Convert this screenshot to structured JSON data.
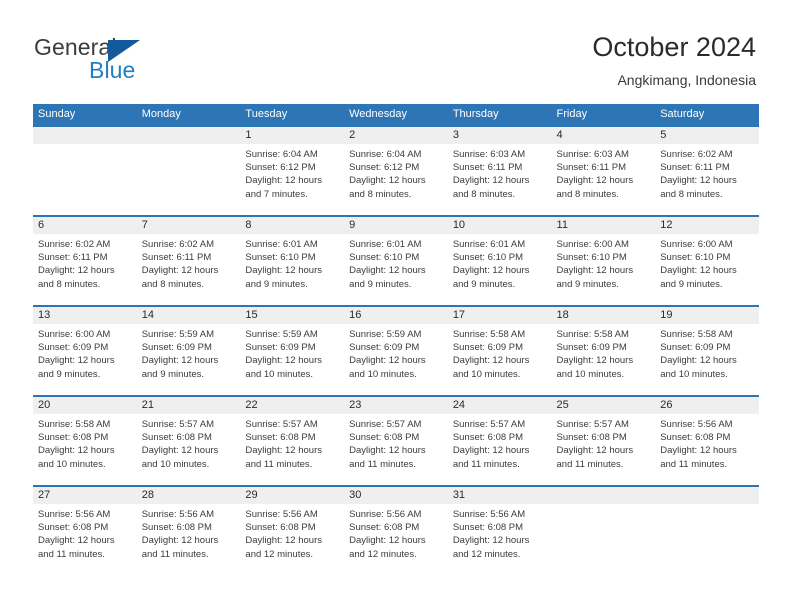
{
  "brand": {
    "line1": "General",
    "line2": "Blue",
    "triangle_icon": "brand-triangle-icon",
    "colors": {
      "dark": "#3c3c3c",
      "blue": "#1f7fc4",
      "triangle": "#125a9c"
    }
  },
  "header": {
    "title": "October 2024",
    "subtitle": "Angkimang, Indonesia"
  },
  "theme": {
    "header_blue": "#2E75B6",
    "row_rule_blue": "#2E75B6",
    "day_number_strip": "#EFEFEF",
    "text": "#3C3C3C"
  },
  "calendar": {
    "weekdays": [
      "Sunday",
      "Monday",
      "Tuesday",
      "Wednesday",
      "Thursday",
      "Friday",
      "Saturday"
    ],
    "weeks": [
      [
        {
          "day": "",
          "empty": true
        },
        {
          "day": "",
          "empty": true
        },
        {
          "day": "1",
          "sunrise": "Sunrise: 6:04 AM",
          "sunset": "Sunset: 6:12 PM",
          "daylight": "Daylight: 12 hours and 7 minutes."
        },
        {
          "day": "2",
          "sunrise": "Sunrise: 6:04 AM",
          "sunset": "Sunset: 6:12 PM",
          "daylight": "Daylight: 12 hours and 8 minutes."
        },
        {
          "day": "3",
          "sunrise": "Sunrise: 6:03 AM",
          "sunset": "Sunset: 6:11 PM",
          "daylight": "Daylight: 12 hours and 8 minutes."
        },
        {
          "day": "4",
          "sunrise": "Sunrise: 6:03 AM",
          "sunset": "Sunset: 6:11 PM",
          "daylight": "Daylight: 12 hours and 8 minutes."
        },
        {
          "day": "5",
          "sunrise": "Sunrise: 6:02 AM",
          "sunset": "Sunset: 6:11 PM",
          "daylight": "Daylight: 12 hours and 8 minutes."
        }
      ],
      [
        {
          "day": "6",
          "sunrise": "Sunrise: 6:02 AM",
          "sunset": "Sunset: 6:11 PM",
          "daylight": "Daylight: 12 hours and 8 minutes."
        },
        {
          "day": "7",
          "sunrise": "Sunrise: 6:02 AM",
          "sunset": "Sunset: 6:11 PM",
          "daylight": "Daylight: 12 hours and 8 minutes."
        },
        {
          "day": "8",
          "sunrise": "Sunrise: 6:01 AM",
          "sunset": "Sunset: 6:10 PM",
          "daylight": "Daylight: 12 hours and 9 minutes."
        },
        {
          "day": "9",
          "sunrise": "Sunrise: 6:01 AM",
          "sunset": "Sunset: 6:10 PM",
          "daylight": "Daylight: 12 hours and 9 minutes."
        },
        {
          "day": "10",
          "sunrise": "Sunrise: 6:01 AM",
          "sunset": "Sunset: 6:10 PM",
          "daylight": "Daylight: 12 hours and 9 minutes."
        },
        {
          "day": "11",
          "sunrise": "Sunrise: 6:00 AM",
          "sunset": "Sunset: 6:10 PM",
          "daylight": "Daylight: 12 hours and 9 minutes."
        },
        {
          "day": "12",
          "sunrise": "Sunrise: 6:00 AM",
          "sunset": "Sunset: 6:10 PM",
          "daylight": "Daylight: 12 hours and 9 minutes."
        }
      ],
      [
        {
          "day": "13",
          "sunrise": "Sunrise: 6:00 AM",
          "sunset": "Sunset: 6:09 PM",
          "daylight": "Daylight: 12 hours and 9 minutes."
        },
        {
          "day": "14",
          "sunrise": "Sunrise: 5:59 AM",
          "sunset": "Sunset: 6:09 PM",
          "daylight": "Daylight: 12 hours and 9 minutes."
        },
        {
          "day": "15",
          "sunrise": "Sunrise: 5:59 AM",
          "sunset": "Sunset: 6:09 PM",
          "daylight": "Daylight: 12 hours and 10 minutes."
        },
        {
          "day": "16",
          "sunrise": "Sunrise: 5:59 AM",
          "sunset": "Sunset: 6:09 PM",
          "daylight": "Daylight: 12 hours and 10 minutes."
        },
        {
          "day": "17",
          "sunrise": "Sunrise: 5:58 AM",
          "sunset": "Sunset: 6:09 PM",
          "daylight": "Daylight: 12 hours and 10 minutes."
        },
        {
          "day": "18",
          "sunrise": "Sunrise: 5:58 AM",
          "sunset": "Sunset: 6:09 PM",
          "daylight": "Daylight: 12 hours and 10 minutes."
        },
        {
          "day": "19",
          "sunrise": "Sunrise: 5:58 AM",
          "sunset": "Sunset: 6:09 PM",
          "daylight": "Daylight: 12 hours and 10 minutes."
        }
      ],
      [
        {
          "day": "20",
          "sunrise": "Sunrise: 5:58 AM",
          "sunset": "Sunset: 6:08 PM",
          "daylight": "Daylight: 12 hours and 10 minutes."
        },
        {
          "day": "21",
          "sunrise": "Sunrise: 5:57 AM",
          "sunset": "Sunset: 6:08 PM",
          "daylight": "Daylight: 12 hours and 10 minutes."
        },
        {
          "day": "22",
          "sunrise": "Sunrise: 5:57 AM",
          "sunset": "Sunset: 6:08 PM",
          "daylight": "Daylight: 12 hours and 11 minutes."
        },
        {
          "day": "23",
          "sunrise": "Sunrise: 5:57 AM",
          "sunset": "Sunset: 6:08 PM",
          "daylight": "Daylight: 12 hours and 11 minutes."
        },
        {
          "day": "24",
          "sunrise": "Sunrise: 5:57 AM",
          "sunset": "Sunset: 6:08 PM",
          "daylight": "Daylight: 12 hours and 11 minutes."
        },
        {
          "day": "25",
          "sunrise": "Sunrise: 5:57 AM",
          "sunset": "Sunset: 6:08 PM",
          "daylight": "Daylight: 12 hours and 11 minutes."
        },
        {
          "day": "26",
          "sunrise": "Sunrise: 5:56 AM",
          "sunset": "Sunset: 6:08 PM",
          "daylight": "Daylight: 12 hours and 11 minutes."
        }
      ],
      [
        {
          "day": "27",
          "sunrise": "Sunrise: 5:56 AM",
          "sunset": "Sunset: 6:08 PM",
          "daylight": "Daylight: 12 hours and 11 minutes."
        },
        {
          "day": "28",
          "sunrise": "Sunrise: 5:56 AM",
          "sunset": "Sunset: 6:08 PM",
          "daylight": "Daylight: 12 hours and 11 minutes."
        },
        {
          "day": "29",
          "sunrise": "Sunrise: 5:56 AM",
          "sunset": "Sunset: 6:08 PM",
          "daylight": "Daylight: 12 hours and 12 minutes."
        },
        {
          "day": "30",
          "sunrise": "Sunrise: 5:56 AM",
          "sunset": "Sunset: 6:08 PM",
          "daylight": "Daylight: 12 hours and 12 minutes."
        },
        {
          "day": "31",
          "sunrise": "Sunrise: 5:56 AM",
          "sunset": "Sunset: 6:08 PM",
          "daylight": "Daylight: 12 hours and 12 minutes."
        },
        {
          "day": "",
          "empty": true
        },
        {
          "day": "",
          "empty": true
        }
      ]
    ]
  }
}
